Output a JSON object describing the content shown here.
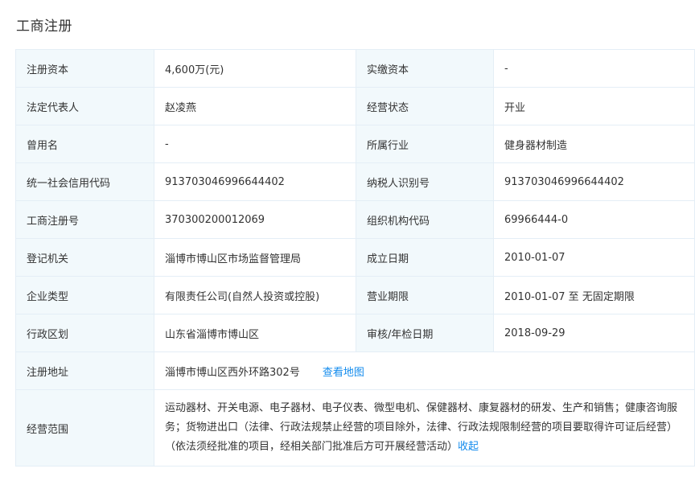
{
  "section": {
    "title": "工商注册"
  },
  "rows": [
    {
      "l1": "注册资本",
      "v1": "4,600万(元)",
      "l2": "实缴资本",
      "v2": "-"
    },
    {
      "l1": "法定代表人",
      "v1": "赵凌燕",
      "l2": "经营状态",
      "v2": "开业"
    },
    {
      "l1": "曾用名",
      "v1": "-",
      "l2": "所属行业",
      "v2": "健身器材制造"
    },
    {
      "l1": "统一社会信用代码",
      "v1": "913703046996644402",
      "l2": "纳税人识别号",
      "v2": "913703046996644402"
    },
    {
      "l1": "工商注册号",
      "v1": "370300200012069",
      "l2": "组织机构代码",
      "v2": "69966444-0"
    },
    {
      "l1": "登记机关",
      "v1": "淄博市博山区市场监督管理局",
      "l2": "成立日期",
      "v2": "2010-01-07"
    },
    {
      "l1": "企业类型",
      "v1": "有限责任公司(自然人投资或控股)",
      "l2": "营业期限",
      "v2": "2010-01-07 至 无固定期限"
    },
    {
      "l1": "行政区划",
      "v1": "山东省淄博市博山区",
      "l2": "审核/年检日期",
      "v2": "2018-09-29"
    }
  ],
  "address": {
    "label": "注册地址",
    "value": "淄博市博山区西外环路302号",
    "map_link": "查看地图"
  },
  "scope": {
    "label": "经营范围",
    "value": "运动器材、开关电源、电子器材、电子仪表、微型电机、保健器材、康复器材的研发、生产和销售；健康咨询服务；货物进出口（法律、行政法规禁止经营的项目除外，法律、行政法规限制经营的项目要取得许可证后经营）（依法须经批准的项目，经相关部门批准后方可开展经营活动）",
    "collapse_link": "收起"
  },
  "colors": {
    "label_bg": "#f2f9fc",
    "border": "#e4eef6",
    "link": "#128bed"
  }
}
